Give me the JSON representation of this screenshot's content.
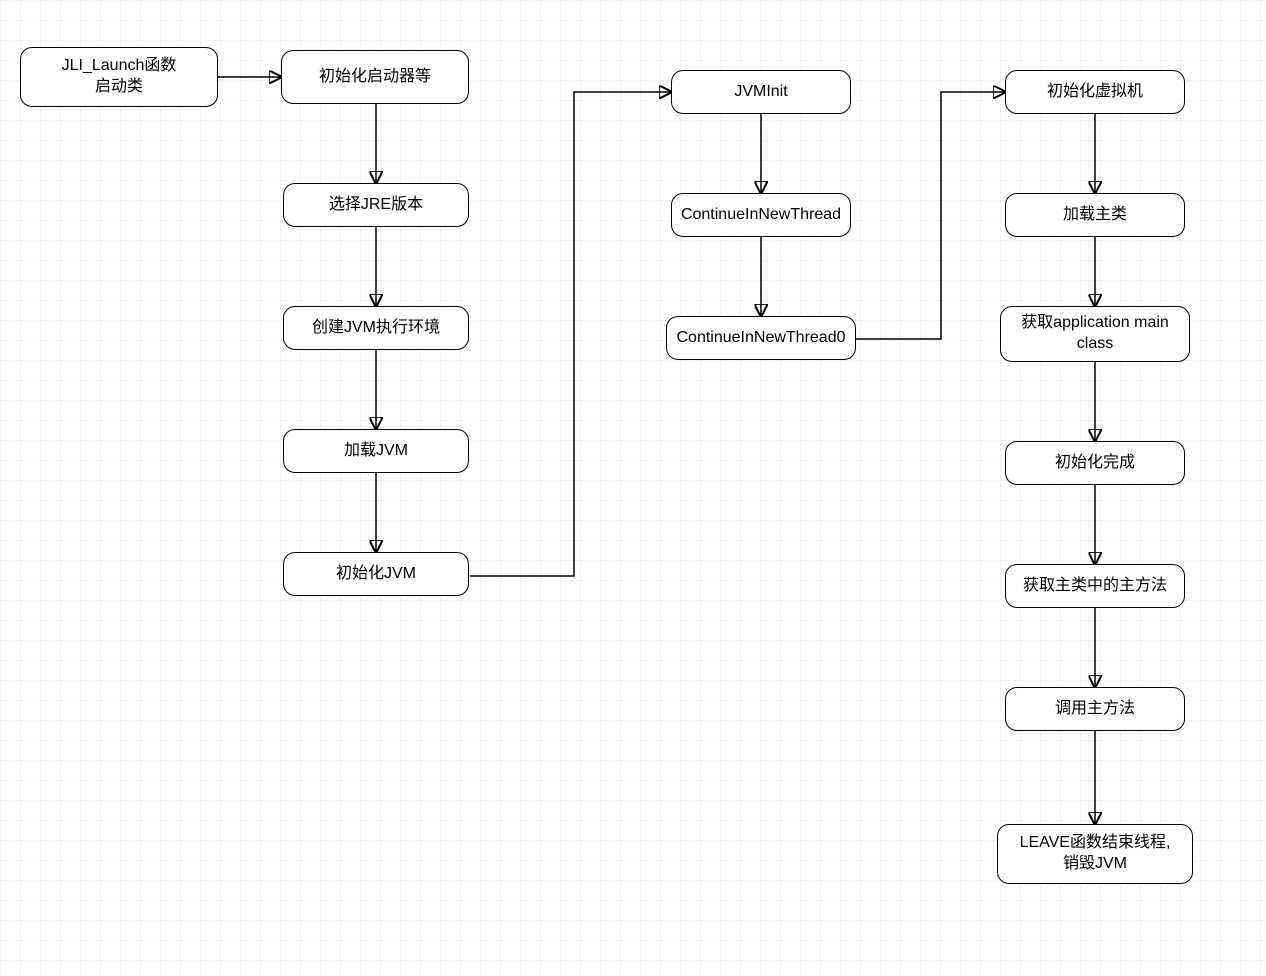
{
  "nodes": {
    "n1": "JLI_Launch函数\n启动类",
    "n2": "初始化启动器等",
    "n3": "选择JRE版本",
    "n4": "创建JVM执行环境",
    "n5": "加载JVM",
    "n6": "初始化JVM",
    "n7": "JVMInit",
    "n8": "ContinueInNewThread",
    "n9": "ContinueInNewThread0",
    "n10": "初始化虚拟机",
    "n11": "加载主类",
    "n12": "获取application main class",
    "n13": "初始化完成",
    "n14": "获取主类中的主方法",
    "n15": "调用主方法",
    "n16": "LEAVE函数结束线程,\n销毁JVM"
  }
}
